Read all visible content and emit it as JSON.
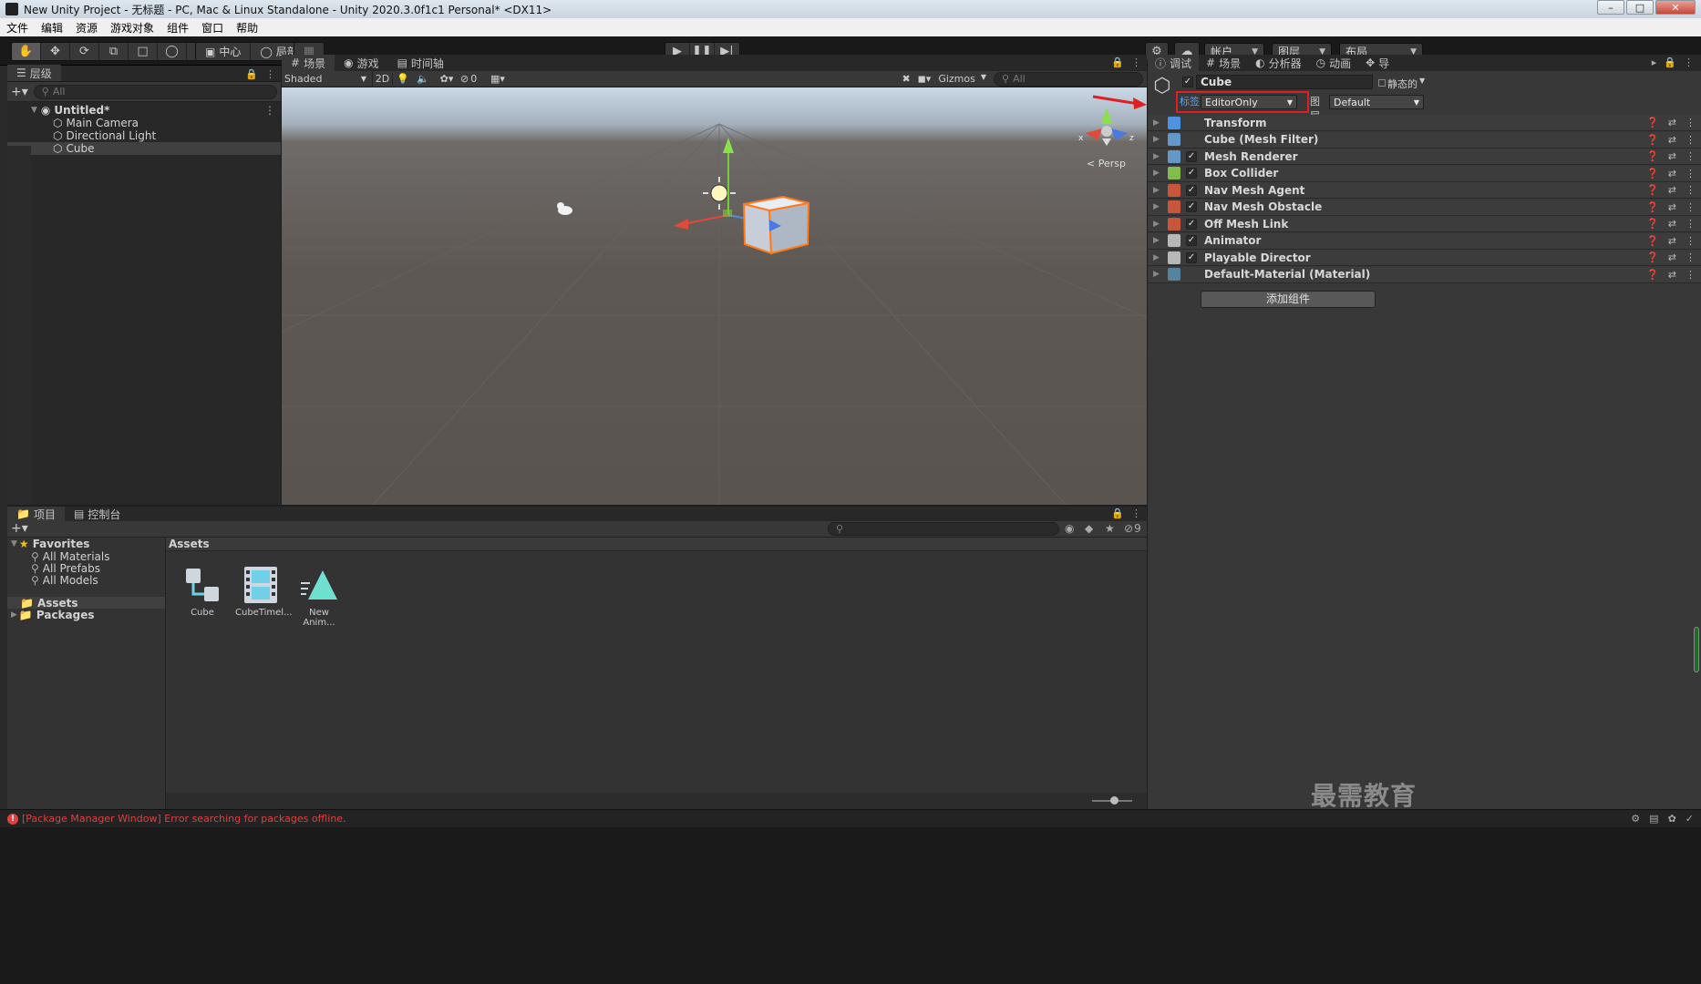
{
  "window": {
    "title": "New Unity Project - 无标题 - PC, Mac & Linux Standalone - Unity 2020.3.0f1c1 Personal* <DX11>"
  },
  "menu": [
    "文件",
    "编辑",
    "资源",
    "游戏对象",
    "组件",
    "窗口",
    "帮助"
  ],
  "toolbar": {
    "pivot_center": "中心",
    "pivot_local": "局部",
    "account": "帐户",
    "layers": "图层",
    "layout": "布局"
  },
  "hierarchy": {
    "tab": "层级",
    "search_placeholder": "All",
    "scene": "Untitled*",
    "items": [
      "Main Camera",
      "Directional Light",
      "Cube"
    ]
  },
  "scene_view": {
    "tabs": [
      "场景",
      "游戏",
      "时间轴"
    ],
    "shading": "Shaded",
    "mode_2d": "2D",
    "hidden_count": "0",
    "gizmos": "Gizmos",
    "search_placeholder": "All",
    "persp_label": "< Persp",
    "axes": {
      "x": "x",
      "z": "z"
    }
  },
  "inspector": {
    "tabs": [
      "调试",
      "场景",
      "分析器",
      "动画",
      "导"
    ],
    "object_name": "Cube",
    "static_label": "静态的",
    "tag_label": "标签",
    "tag_value": "EditorOnly",
    "layer_label": "图层",
    "layer_value": "Default",
    "components": [
      {
        "name": "Transform",
        "checkbox": false,
        "color": "#4fa3ff"
      },
      {
        "name": "Cube (Mesh Filter)",
        "checkbox": false,
        "color": "#6aa8e0"
      },
      {
        "name": "Mesh Renderer",
        "checkbox": true,
        "color": "#6aa8e0"
      },
      {
        "name": "Box Collider",
        "checkbox": true,
        "color": "#8fd14f"
      },
      {
        "name": "Nav Mesh Agent",
        "checkbox": true,
        "color": "#e05a3a"
      },
      {
        "name": "Nav Mesh Obstacle",
        "checkbox": true,
        "color": "#e05a3a"
      },
      {
        "name": "Off Mesh Link",
        "checkbox": true,
        "color": "#e05a3a"
      },
      {
        "name": "Animator",
        "checkbox": true,
        "color": "#cccccc"
      },
      {
        "name": "Playable Director",
        "checkbox": true,
        "color": "#cccccc"
      },
      {
        "name": "Default-Material (Material)",
        "checkbox": false,
        "color": "#5a8fb0"
      }
    ],
    "add_component": "添加组件"
  },
  "project": {
    "tabs": [
      "项目",
      "控制台"
    ],
    "hidden_count": "9",
    "favorites": "Favorites",
    "favorite_items": [
      "All Materials",
      "All Prefabs",
      "All Models"
    ],
    "folders": [
      "Assets",
      "Packages"
    ],
    "breadcrumb": "Assets",
    "assets": [
      {
        "label": "Cube",
        "icon": "prefab-icon"
      },
      {
        "label": "CubeTimel...",
        "icon": "timeline-icon"
      },
      {
        "label": "New Anim...",
        "icon": "animation-icon"
      }
    ]
  },
  "status": {
    "message": "[Package Manager Window] Error searching for packages offline."
  },
  "watermark": "最需教育",
  "colors": {
    "accent_blue": "#3a79bb",
    "selection_orange": "#ff7a1a",
    "highlight_red": "#e02020",
    "error_red": "#e04040"
  }
}
